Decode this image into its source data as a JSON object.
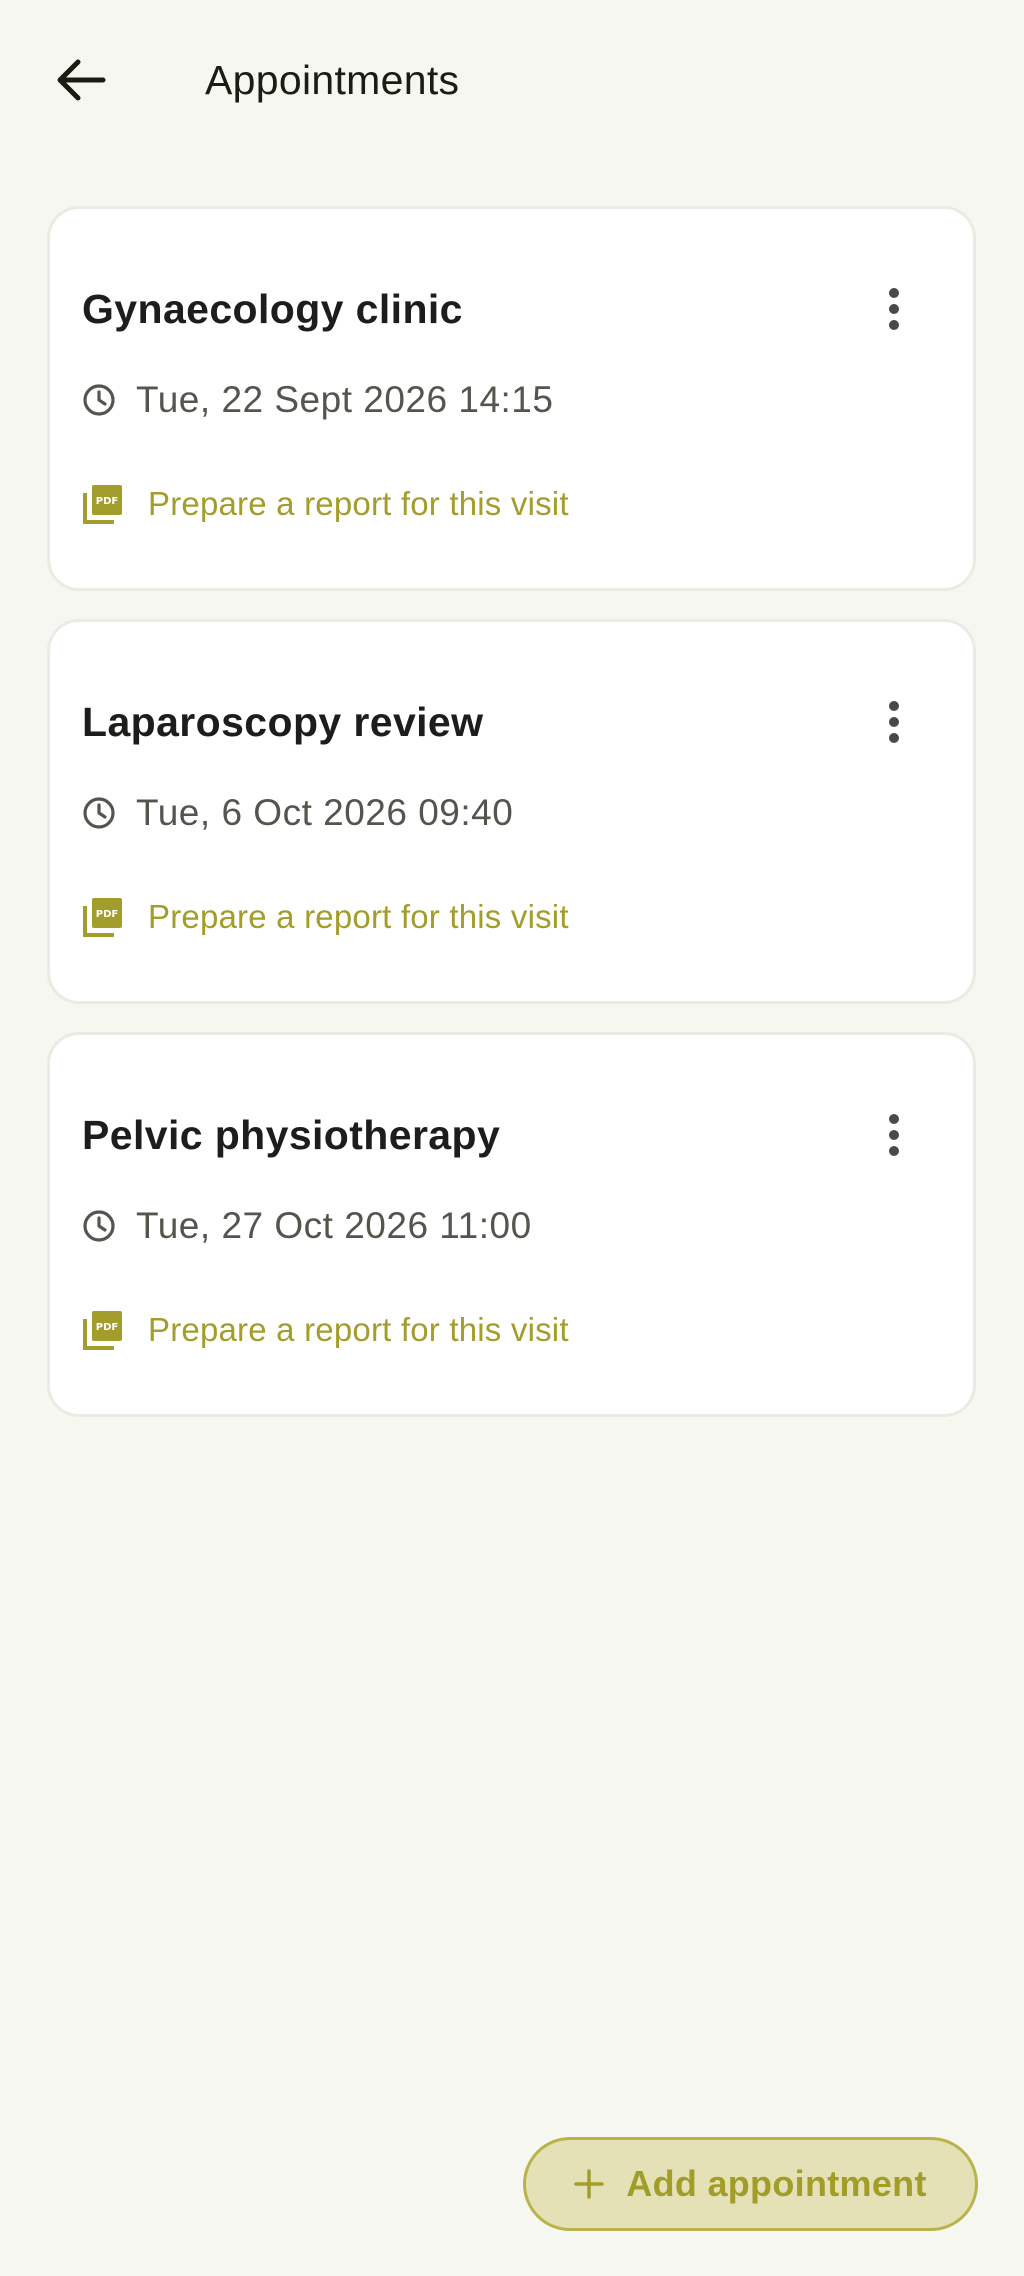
{
  "header": {
    "title": "Appointments",
    "back_icon": "arrow-left-icon"
  },
  "appointments": [
    {
      "title": "Gynaecology clinic",
      "datetime": "Tue, 22 Sept 2026 14:15",
      "report_label": "Prepare a report for this visit"
    },
    {
      "title": "Laparoscopy review",
      "datetime": "Tue, 6 Oct 2026 09:40",
      "report_label": "Prepare a report for this visit"
    },
    {
      "title": "Pelvic physiotherapy",
      "datetime": "Tue, 27 Oct 2026 11:00",
      "report_label": "Prepare a report for this visit"
    }
  ],
  "icons": {
    "more": "more-vertical-icon",
    "clock": "clock-icon",
    "pdf": "pdf-file-icon",
    "add": "plus-icon"
  },
  "pdf_icon_text": "PDF",
  "fab": {
    "label": "Add appointment"
  },
  "colors": {
    "background": "#f7f7f2",
    "card": "#ffffff",
    "accent": "#a39e2c",
    "fab_background": "#e5e1b6",
    "fab_border": "#b8b34a"
  }
}
